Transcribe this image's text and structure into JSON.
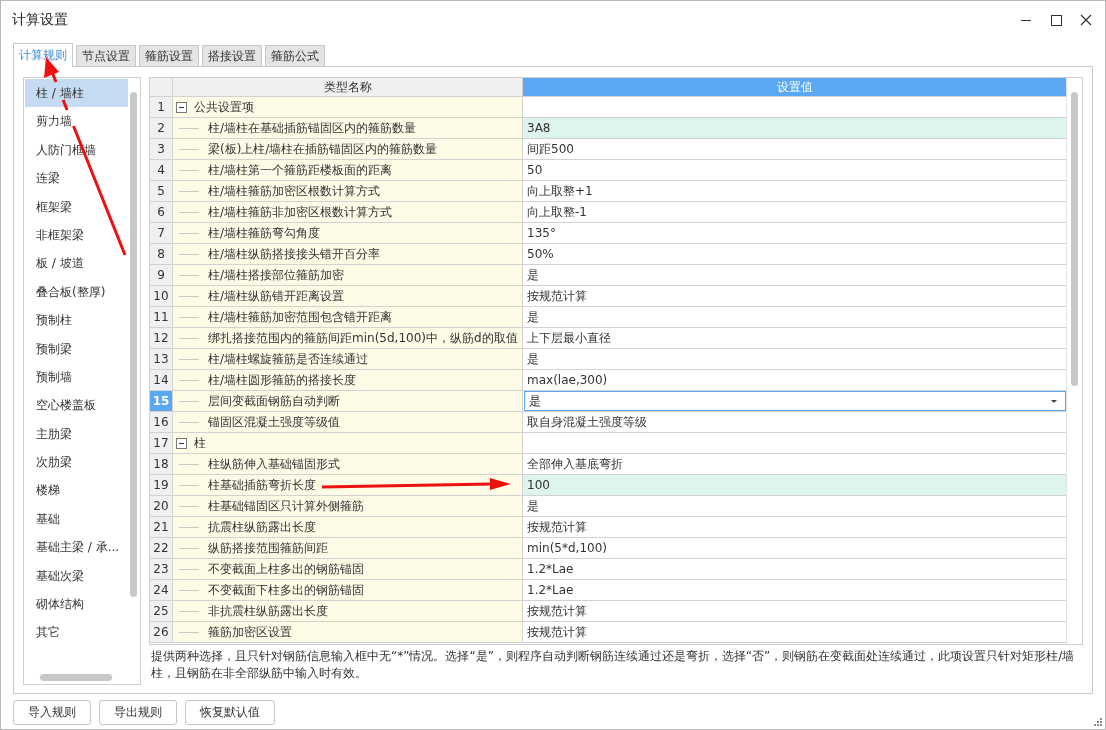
{
  "window": {
    "title": "计算设置"
  },
  "tabs": [
    {
      "label": "计算规则",
      "selected": true
    },
    {
      "label": "节点设置",
      "selected": false
    },
    {
      "label": "箍筋设置",
      "selected": false
    },
    {
      "label": "搭接设置",
      "selected": false
    },
    {
      "label": "箍筋公式",
      "selected": false
    }
  ],
  "sidebar": {
    "items": [
      {
        "label": "柱 / 墙柱",
        "selected": true
      },
      {
        "label": "剪力墙",
        "selected": false
      },
      {
        "label": "人防门框墙",
        "selected": false
      },
      {
        "label": "连梁",
        "selected": false
      },
      {
        "label": "框架梁",
        "selected": false
      },
      {
        "label": "非框架梁",
        "selected": false
      },
      {
        "label": "板 / 坡道",
        "selected": false
      },
      {
        "label": "叠合板(整厚)",
        "selected": false
      },
      {
        "label": "预制柱",
        "selected": false
      },
      {
        "label": "预制梁",
        "selected": false
      },
      {
        "label": "预制墙",
        "selected": false
      },
      {
        "label": "空心楼盖板",
        "selected": false
      },
      {
        "label": "主肋梁",
        "selected": false
      },
      {
        "label": "次肋梁",
        "selected": false
      },
      {
        "label": "楼梯",
        "selected": false
      },
      {
        "label": "基础",
        "selected": false
      },
      {
        "label": "基础主梁 / 承...",
        "selected": false
      },
      {
        "label": "基础次梁",
        "selected": false
      },
      {
        "label": "砌体结构",
        "selected": false
      },
      {
        "label": "其它",
        "selected": false
      }
    ]
  },
  "table": {
    "columns": [
      "类型名称",
      "设置值"
    ],
    "rows": [
      {
        "number": "1",
        "kind": "group",
        "name": "公共设置项",
        "expanded": true,
        "selected": false,
        "highlighted": false
      },
      {
        "number": "2",
        "kind": "setting",
        "name": "柱/墙柱在基础插筋锚固区内的箍筋数量",
        "value": "3A8",
        "selected": false,
        "highlighted": true
      },
      {
        "number": "3",
        "kind": "setting",
        "name": "梁(板)上柱/墙柱在插筋锚固区内的箍筋数量",
        "value": "间距500",
        "selected": false,
        "highlighted": false
      },
      {
        "number": "4",
        "kind": "setting",
        "name": "柱/墙柱第一个箍筋距楼板面的距离",
        "value": "50",
        "selected": false,
        "highlighted": false
      },
      {
        "number": "5",
        "kind": "setting",
        "name": "柱/墙柱箍筋加密区根数计算方式",
        "value": "向上取整+1",
        "selected": false,
        "highlighted": false
      },
      {
        "number": "6",
        "kind": "setting",
        "name": "柱/墙柱箍筋非加密区根数计算方式",
        "value": "向上取整-1",
        "selected": false,
        "highlighted": false
      },
      {
        "number": "7",
        "kind": "setting",
        "name": "柱/墙柱箍筋弯勾角度",
        "value": "135°",
        "selected": false,
        "highlighted": false
      },
      {
        "number": "8",
        "kind": "setting",
        "name": "柱/墙柱纵筋搭接接头错开百分率",
        "value": "50%",
        "selected": false,
        "highlighted": false
      },
      {
        "number": "9",
        "kind": "setting",
        "name": "柱/墙柱搭接部位箍筋加密",
        "value": "是",
        "selected": false,
        "highlighted": false
      },
      {
        "number": "10",
        "kind": "setting",
        "name": "柱/墙柱纵筋错开距离设置",
        "value": "按规范计算",
        "selected": false,
        "highlighted": false
      },
      {
        "number": "11",
        "kind": "setting",
        "name": "柱/墙柱箍筋加密范围包含错开距离",
        "value": "是",
        "selected": false,
        "highlighted": false
      },
      {
        "number": "12",
        "kind": "setting",
        "name": "绑扎搭接范围内的箍筋间距min(5d,100)中，纵筋d的取值",
        "value": "上下层最小直径",
        "selected": false,
        "highlighted": false
      },
      {
        "number": "13",
        "kind": "setting",
        "name": "柱/墙柱螺旋箍筋是否连续通过",
        "value": "是",
        "selected": false,
        "highlighted": false
      },
      {
        "number": "14",
        "kind": "setting",
        "name": "柱/墙柱圆形箍筋的搭接长度",
        "value": "max(lae,300)",
        "selected": false,
        "highlighted": false
      },
      {
        "number": "15",
        "kind": "setting",
        "name": "层间变截面钢筋自动判断",
        "value": "是",
        "selected": true,
        "highlighted": false
      },
      {
        "number": "16",
        "kind": "setting",
        "name": "锚固区混凝土强度等级值",
        "value": "取自身混凝土强度等级",
        "selected": false,
        "highlighted": false
      },
      {
        "number": "17",
        "kind": "group",
        "name": "柱",
        "expanded": true,
        "selected": false,
        "highlighted": false
      },
      {
        "number": "18",
        "kind": "setting",
        "name": "柱纵筋伸入基础锚固形式",
        "value": "全部伸入基底弯折",
        "selected": false,
        "highlighted": false
      },
      {
        "number": "19",
        "kind": "setting",
        "name": "柱基础插筋弯折长度",
        "value": "100",
        "selected": false,
        "highlighted": true
      },
      {
        "number": "20",
        "kind": "setting",
        "name": "柱基础锚固区只计算外侧箍筋",
        "value": "是",
        "selected": false,
        "highlighted": false
      },
      {
        "number": "21",
        "kind": "setting",
        "name": "抗震柱纵筋露出长度",
        "value": "按规范计算",
        "selected": false,
        "highlighted": false
      },
      {
        "number": "22",
        "kind": "setting",
        "name": "纵筋搭接范围箍筋间距",
        "value": "min(5*d,100)",
        "selected": false,
        "highlighted": false
      },
      {
        "number": "23",
        "kind": "setting",
        "name": "不变截面上柱多出的钢筋锚固",
        "value": "1.2*Lae",
        "selected": false,
        "highlighted": false
      },
      {
        "number": "24",
        "kind": "setting",
        "name": "不变截面下柱多出的钢筋锚固",
        "value": "1.2*Lae",
        "selected": false,
        "highlighted": false
      },
      {
        "number": "25",
        "kind": "setting",
        "name": "非抗震柱纵筋露出长度",
        "value": "按规范计算",
        "selected": false,
        "highlighted": false
      },
      {
        "number": "26",
        "kind": "setting",
        "name": "箍筋加密区设置",
        "value": "按规范计算",
        "selected": false,
        "highlighted": false
      }
    ]
  },
  "description": "提供两种选择，且只针对钢筋信息输入框中无“*”情况。选择“是”，则程序自动判断钢筋连续通过还是弯折，选择“否”，则钢筋在变截面处连续通过，此项设置只针对矩形柱/墙柱，且钢筋在非全部纵筋中输入时有效。",
  "buttons": [
    "导入规则",
    "导出规则",
    "恢复默认值"
  ]
}
